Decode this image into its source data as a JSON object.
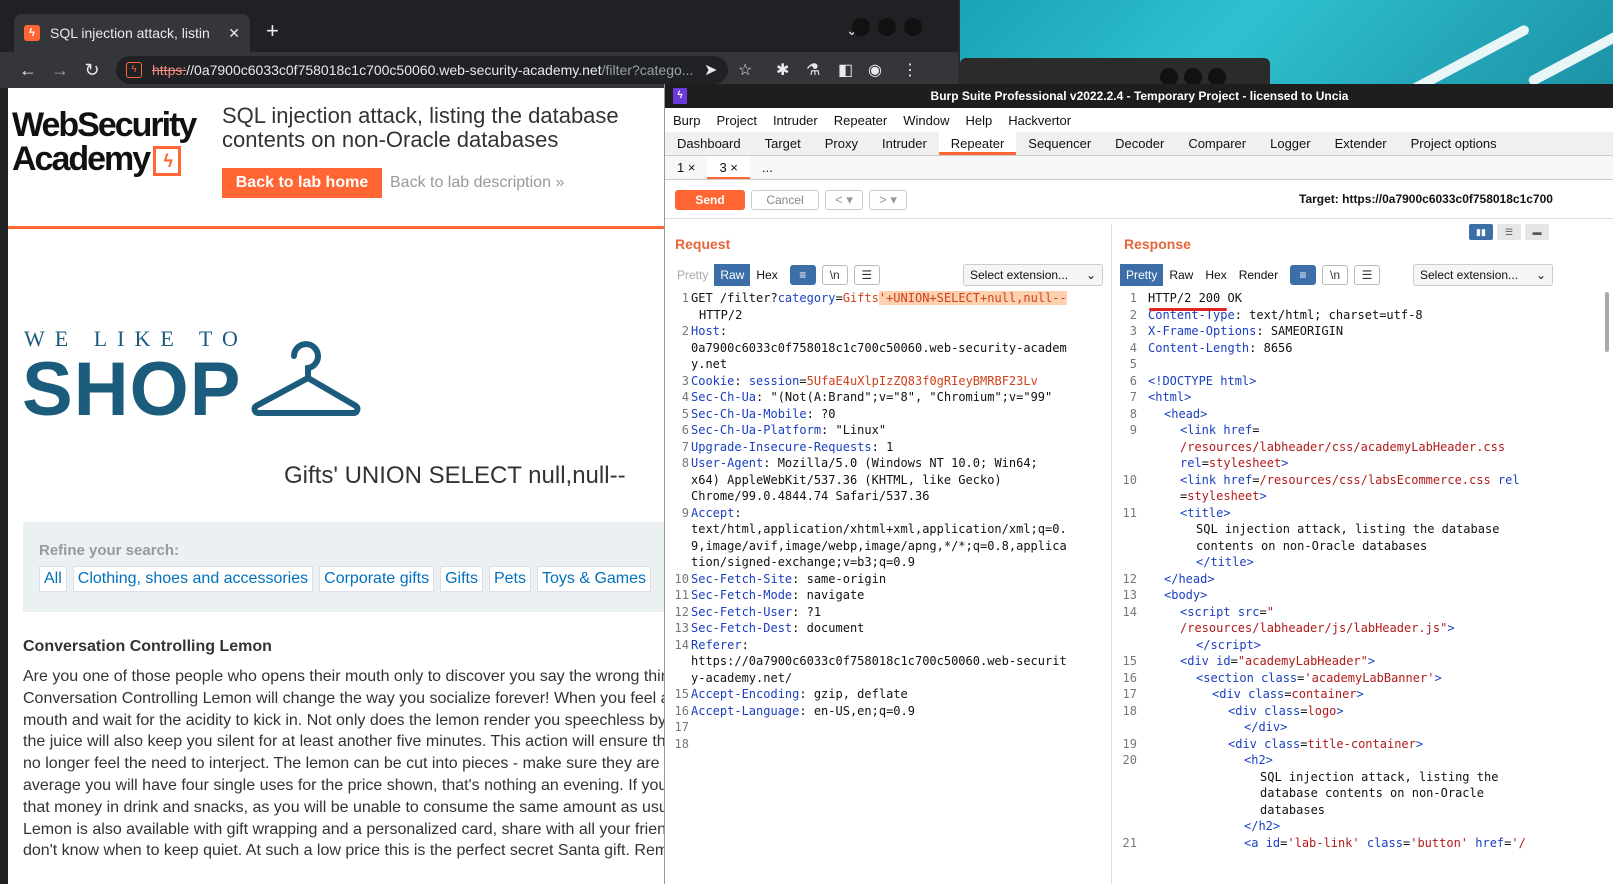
{
  "browser": {
    "tab_title": "SQL injection attack, listin",
    "url_proto": "https:",
    "url_host": "//0a7900c6033c0f758018c1c700c50060.web-security-academy.net",
    "url_path": "/filter?catego..."
  },
  "page": {
    "logo_line1": "WebSecurity",
    "logo_line2": "Academy",
    "lab_title": "SQL injection attack, listing the database contents on non-Oracle databases",
    "back_home": "Back to lab home",
    "back_desc": "Back to lab description",
    "shop_we": "WE LIKE TO",
    "shop_big": "SHOP",
    "search_term": "Gifts' UNION SELECT null,null--",
    "refine_label": "Refine your search:",
    "filters": [
      "All",
      "Clothing, shoes and accessories",
      "Corporate gifts",
      "Gifts",
      "Pets",
      "Toys & Games"
    ],
    "product_title": "Conversation Controlling Lemon",
    "product_lines": [
      "Are you one of those people who opens their mouth only to discover you say the wrong thing",
      "Conversation Controlling Lemon will change the way you socialize forever! When you feel a q",
      "mouth and wait for the acidity to kick in. Not only does the lemon render you speechless by b",
      "the juice will also keep you silent for at least another five minutes. This action will ensure the",
      "no longer feel the need to interject. The lemon can be cut into pieces - make sure they are la",
      "average you will have four single uses for the price shown, that's nothing an evening. If you'r",
      "that money in drink and snacks, as you will be unable to consume the same amount as usua",
      "Lemon is also available with gift wrapping and a personalized card, share with all your friends",
      "don't know when to keep quiet. At such a low price this is the perfect secret Santa gift. Reme"
    ]
  },
  "burp": {
    "title": "Burp Suite Professional v2022.2.4 - Temporary Project - licensed to Uncia",
    "menu": [
      "Burp",
      "Project",
      "Intruder",
      "Repeater",
      "Window",
      "Help",
      "Hackvertor"
    ],
    "tabs": [
      "Dashboard",
      "Target",
      "Proxy",
      "Intruder",
      "Repeater",
      "Sequencer",
      "Decoder",
      "Comparer",
      "Logger",
      "Extender",
      "Project options"
    ],
    "active_tab": "Repeater",
    "repeater_tabs": [
      "1 ×",
      "3 ×",
      "..."
    ],
    "send": "Send",
    "cancel": "Cancel",
    "prev": "< ▾",
    "next": "> ▾",
    "target": "Target: https://0a7900c6033c0f758018c1c700",
    "request_title": "Request",
    "response_title": "Response",
    "req_tabs": [
      "Pretty",
      "Raw",
      "Hex"
    ],
    "resp_tabs": [
      "Pretty",
      "Raw",
      "Hex",
      "Render"
    ],
    "select_ext": "Select extension...",
    "newline_btn": "\\n"
  },
  "colors": {
    "accent": "#ff6633",
    "link": "#0071bc",
    "shop": "#1b5c7d",
    "burp_tab_active": "#3c6ea8"
  }
}
